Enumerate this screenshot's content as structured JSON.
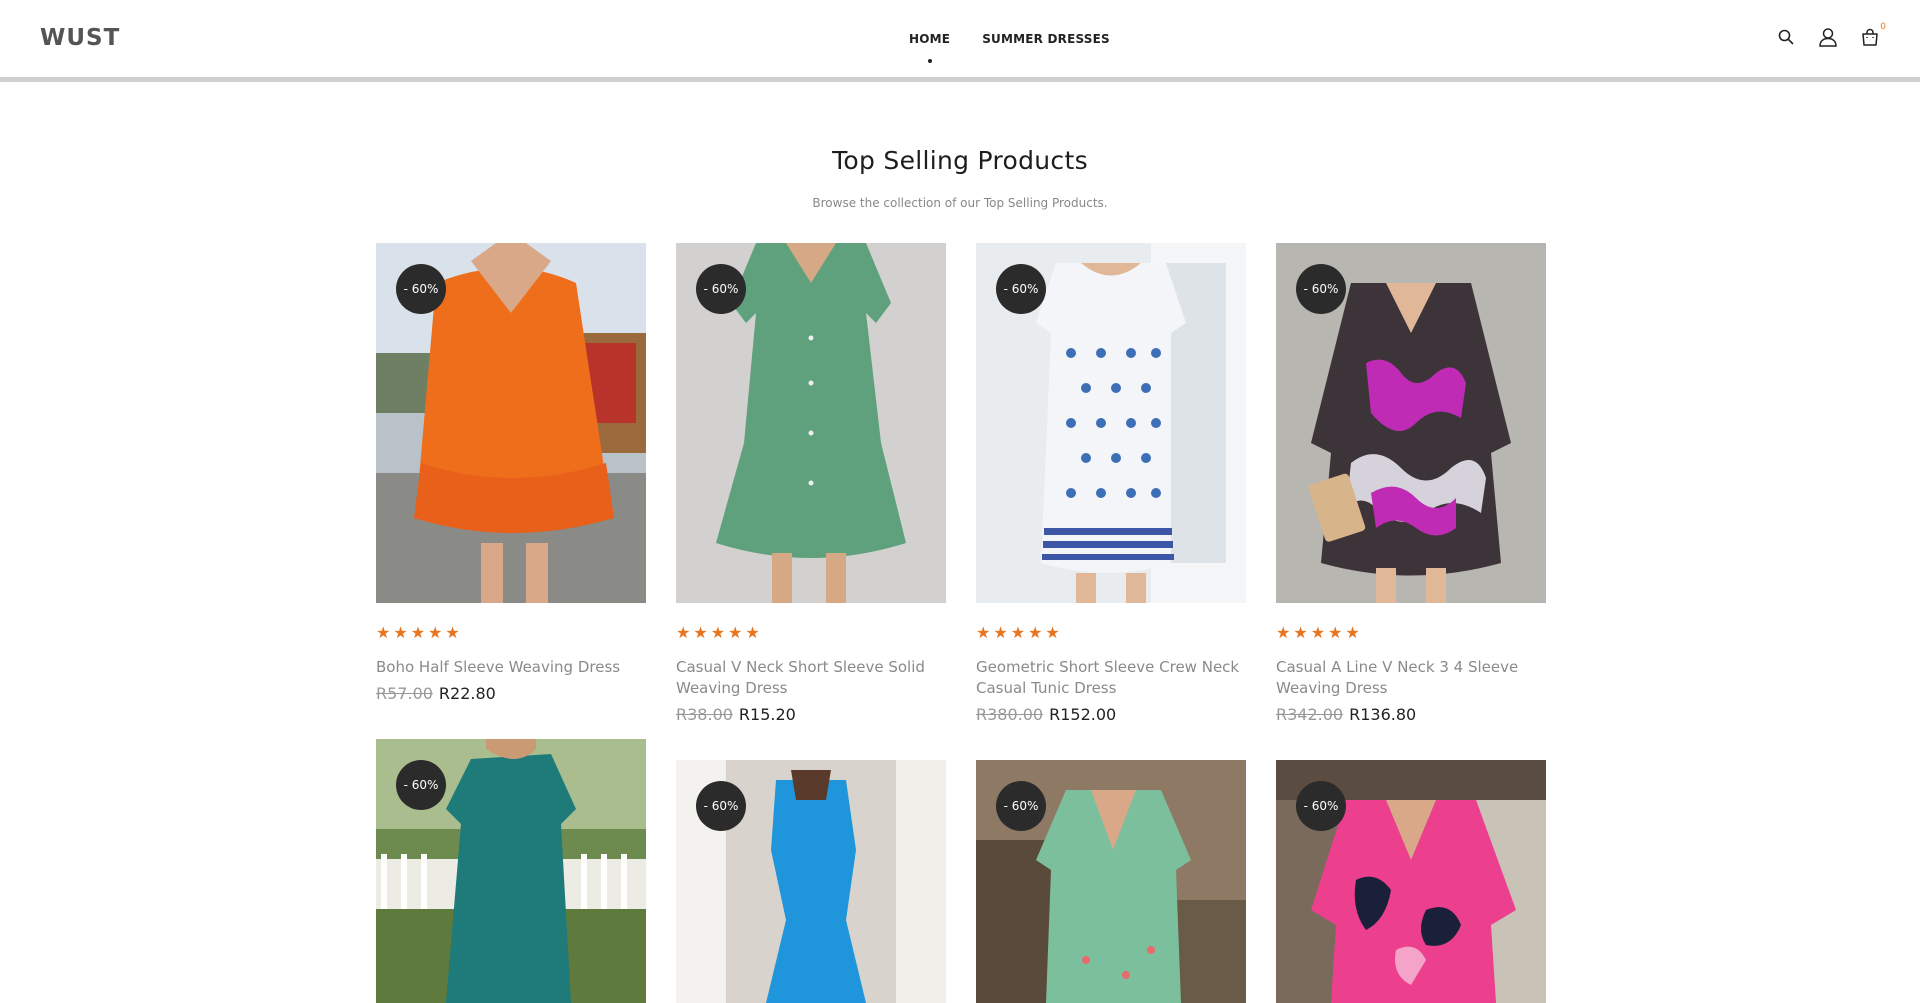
{
  "header": {
    "logo": "WUST",
    "nav": [
      {
        "label": "HOME"
      },
      {
        "label": "SUMMER DRESSES"
      }
    ],
    "icons": [
      "search-icon",
      "user-icon",
      "cart-icon"
    ],
    "cart_count": "0"
  },
  "section": {
    "title": "Top Selling Products",
    "subtitle": "Browse the collection of our Top Selling Products."
  },
  "colors": {
    "accent": "#e8761f",
    "badge_bg": "#2b2b2b"
  },
  "products": [
    {
      "badge": "- 60%",
      "title": "Boho Half Sleeve Weaving Dress",
      "old_price": "R57.00",
      "new_price": "R22.80",
      "rating": 5
    },
    {
      "badge": "- 60%",
      "title": "Casual V Neck Short Sleeve Solid Weaving Dress",
      "old_price": "R38.00",
      "new_price": "R15.20",
      "rating": 5
    },
    {
      "badge": "- 60%",
      "title": "Geometric Short Sleeve Crew Neck Casual Tunic Dress",
      "old_price": "R380.00",
      "new_price": "R152.00",
      "rating": 5
    },
    {
      "badge": "- 60%",
      "title": "Casual A Line V Neck 3 4 Sleeve Weaving Dress",
      "old_price": "R342.00",
      "new_price": "R136.80",
      "rating": 5
    },
    {
      "badge": "- 60%"
    },
    {
      "badge": "- 60%"
    },
    {
      "badge": "- 60%"
    },
    {
      "badge": "- 60%"
    }
  ]
}
